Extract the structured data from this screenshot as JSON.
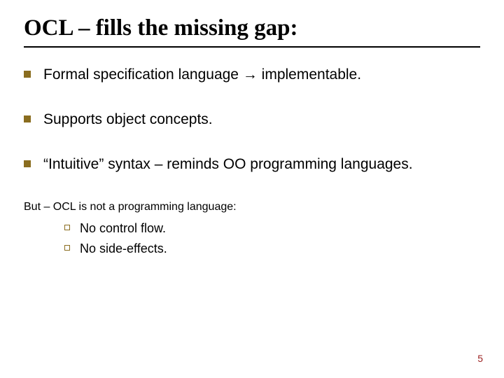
{
  "title": "OCL – fills the missing gap:",
  "bullets": [
    {
      "text": "Formal specification language → implementable."
    },
    {
      "text": "Supports object concepts."
    },
    {
      "text": "“Intuitive” syntax – reminds OO programming languages."
    },
    {
      "text": "But – OCL is not a programming language:",
      "sub": [
        "No control flow.",
        "No side-effects."
      ]
    }
  ],
  "pageNumber": "5"
}
